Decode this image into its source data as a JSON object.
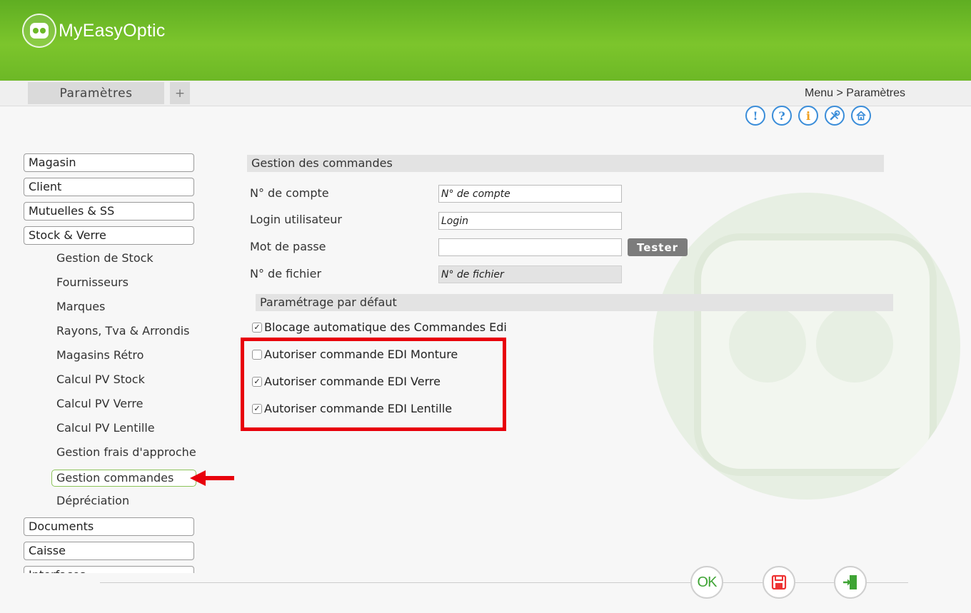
{
  "app": {
    "name": "MyEasyOptic"
  },
  "tabs": {
    "active": "Paramètres",
    "add": "+"
  },
  "breadcrumb": "Menu > Paramètres",
  "help_icons": [
    "alert-icon",
    "question-icon",
    "info-icon",
    "tools-icon",
    "home-icon"
  ],
  "sidebar": {
    "top": [
      "Magasin",
      "Client",
      "Mutuelles & SS",
      "Stock & Verre"
    ],
    "sub": [
      "Gestion de Stock",
      "Fournisseurs",
      "Marques",
      "Rayons, Tva & Arrondis",
      "Magasins Rétro",
      "Calcul PV Stock",
      "Calcul PV Verre",
      "Calcul PV Lentille",
      "Gestion frais d'approche",
      "Gestion commandes",
      "Dépréciation"
    ],
    "active_sub": "Gestion commandes",
    "bottom": [
      "Documents",
      "Caisse",
      "Interfaces"
    ]
  },
  "form": {
    "section_title": "Gestion des commandes",
    "account_label": "N° de compte",
    "account_placeholder": "N° de compte",
    "login_label": "Login utilisateur",
    "login_placeholder": "Login",
    "password_label": "Mot de passe",
    "password_value": "",
    "test_button": "Tester",
    "file_label": "N° de fichier",
    "file_placeholder": "N° de fichier",
    "defaults_title": "Paramétrage par défaut",
    "options": [
      {
        "label": "Blocage automatique des Commandes Edi",
        "checked": true
      },
      {
        "label": "Autoriser commande EDI Monture",
        "checked": false
      },
      {
        "label": "Autoriser commande EDI Verre",
        "checked": true
      },
      {
        "label": "Autoriser commande EDI Lentille",
        "checked": true
      }
    ]
  },
  "footer": {
    "ok_label": "OK"
  },
  "colors": {
    "header_green": "#6cb827",
    "highlight_red": "#e8000b",
    "link_blue": "#3a8dd9"
  }
}
